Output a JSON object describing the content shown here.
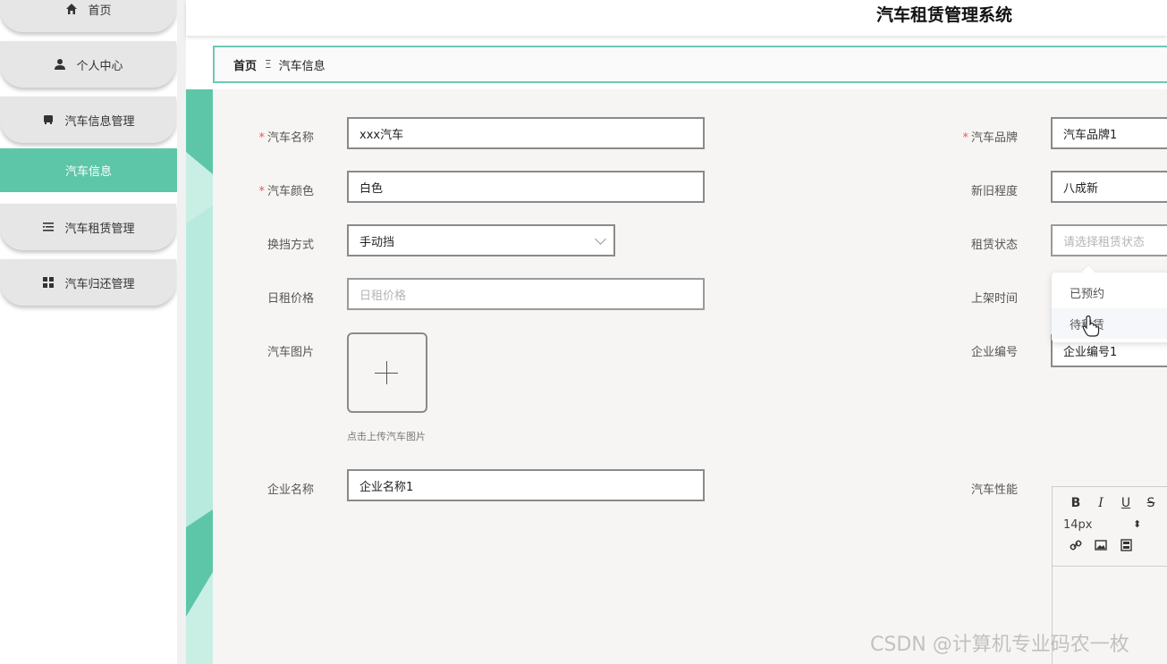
{
  "app": {
    "title": "汽车租赁管理系统",
    "watermark": "CSDN @计算机专业码农一枚"
  },
  "sidebar": {
    "items": [
      {
        "label": "首页",
        "icon": "home-icon"
      },
      {
        "label": "个人中心",
        "icon": "user-icon"
      },
      {
        "label": "汽车信息管理",
        "icon": "car-icon"
      },
      {
        "label": "汽车租赁管理",
        "icon": "list-icon"
      },
      {
        "label": "汽车归还管理",
        "icon": "grid-icon"
      }
    ],
    "active_sub": "汽车信息"
  },
  "breadcrumb": {
    "home": "首页",
    "separator": "Ξ",
    "current": "汽车信息"
  },
  "form": {
    "car_name": {
      "label": "汽车名称",
      "required_mark": "*",
      "value": "xxx汽车"
    },
    "car_brand": {
      "label": "汽车品牌",
      "required_mark": "*",
      "value": "汽车品牌1"
    },
    "car_color": {
      "label": "汽车颜色",
      "required_mark": "*",
      "value": "白色"
    },
    "condition": {
      "label": "新旧程度",
      "value": "八成新"
    },
    "transmission": {
      "label": "换挡方式",
      "value": "手动挡"
    },
    "rent_status": {
      "label": "租赁状态",
      "placeholder": "请选择租赁状态",
      "options": [
        "已预约",
        "待租赁"
      ],
      "hovered_index": 1
    },
    "daily_price": {
      "label": "日租价格",
      "placeholder": "日租价格"
    },
    "listing_time": {
      "label": "上架时间"
    },
    "car_image": {
      "label": "汽车图片",
      "hint": "点击上传汽车图片"
    },
    "company_no": {
      "label": "企业编号",
      "value": "企业编号1"
    },
    "company_name": {
      "label": "企业名称",
      "value": "企业名称1"
    },
    "performance": {
      "label": "汽车性能",
      "font_size": "14px"
    }
  },
  "editor_toolbar": {
    "bold": "B",
    "italic": "I",
    "underline": "U",
    "strike": "S"
  },
  "colors": {
    "accent": "#5ec6a8",
    "required": "#e05a5a"
  }
}
